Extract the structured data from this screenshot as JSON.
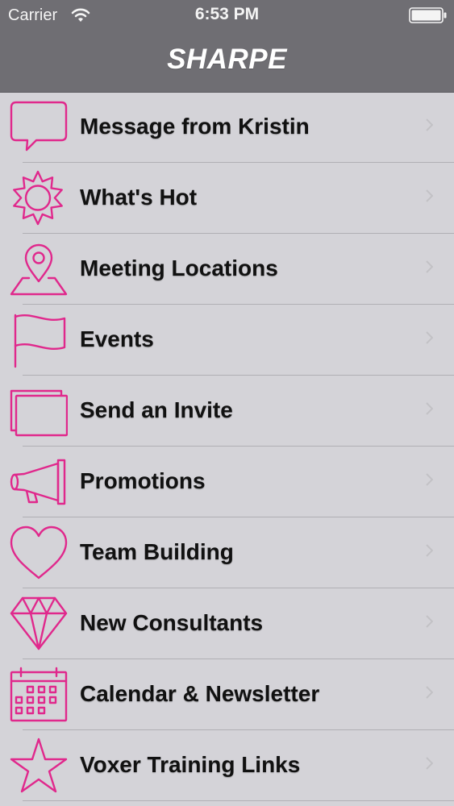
{
  "status_bar": {
    "carrier": "Carrier",
    "time": "6:53 PM"
  },
  "nav_bar": {
    "title": "SHARPE"
  },
  "colors": {
    "accent": "#e0288c",
    "nav_background": "#6f6e73",
    "list_background": "#d4d3d8"
  },
  "menu": {
    "items": [
      {
        "label": "Message from Kristin",
        "icon": "speech-bubble-icon"
      },
      {
        "label": "What's Hot",
        "icon": "sun-icon"
      },
      {
        "label": "Meeting Locations",
        "icon": "map-pin-icon"
      },
      {
        "label": "Events",
        "icon": "flag-icon"
      },
      {
        "label": "Send an Invite",
        "icon": "cards-icon"
      },
      {
        "label": "Promotions",
        "icon": "megaphone-icon"
      },
      {
        "label": "Team Building",
        "icon": "heart-icon"
      },
      {
        "label": "New Consultants",
        "icon": "diamond-icon"
      },
      {
        "label": "Calendar & Newsletter",
        "icon": "calendar-icon"
      },
      {
        "label": "Voxer Training Links",
        "icon": "star-icon"
      }
    ]
  }
}
